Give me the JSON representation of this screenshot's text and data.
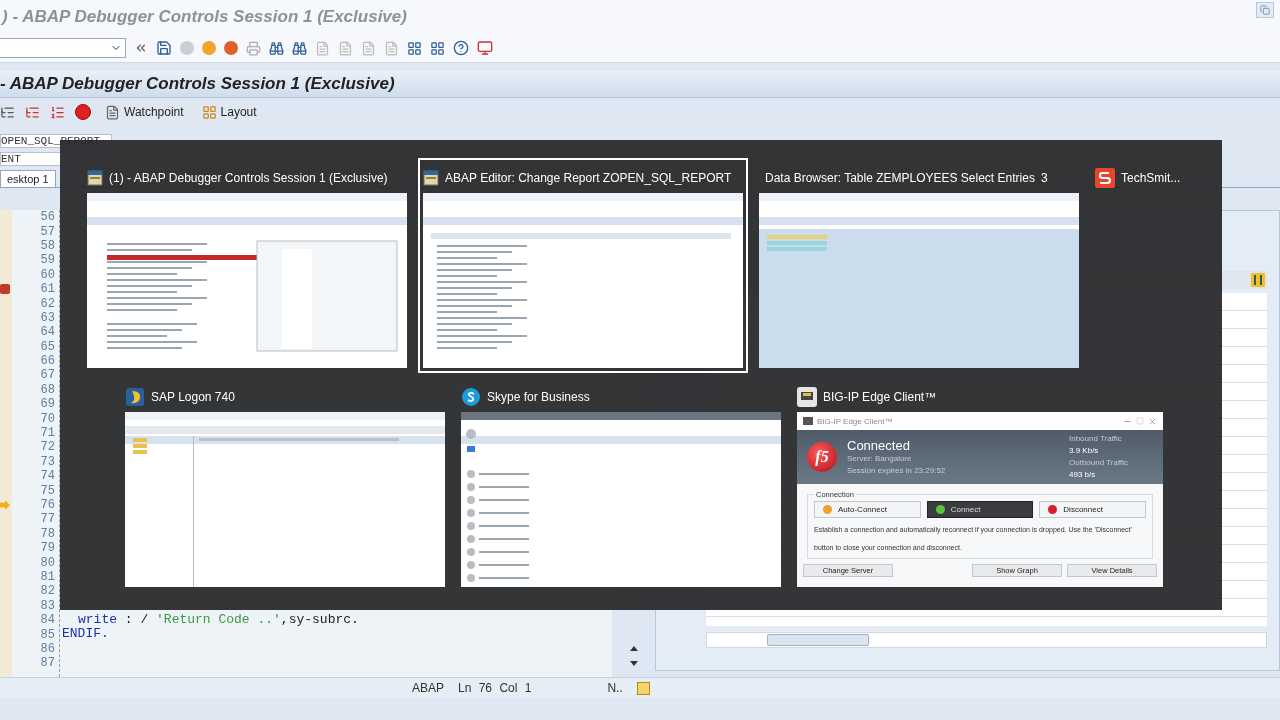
{
  "window": {
    "title": ") - ABAP Debugger Controls Session 1 (Exclusive)"
  },
  "screen_title": "- ABAP Debugger Controls Session 1 (Exclusive)",
  "app_toolbar": [
    {
      "label": "Watchpoint",
      "kind": "page"
    },
    {
      "label": "Layout",
      "kind": "layout"
    }
  ],
  "fields": [
    "OPEN_SQL_REPORT",
    "ENT"
  ],
  "tabs": [
    {
      "label": "esktop 1",
      "selected": true
    }
  ],
  "editor": {
    "lines": [
      {
        "number": "56",
        "breakpoint": false,
        "current": false
      },
      {
        "number": "57",
        "breakpoint": false,
        "current": false
      },
      {
        "number": "58",
        "breakpoint": false,
        "current": false
      },
      {
        "number": "59",
        "breakpoint": false,
        "current": false
      },
      {
        "number": "60",
        "breakpoint": false,
        "current": false
      },
      {
        "number": "61",
        "breakpoint": true,
        "current": false
      },
      {
        "number": "62",
        "breakpoint": false,
        "current": false
      },
      {
        "number": "63",
        "breakpoint": false,
        "current": false
      },
      {
        "number": "64",
        "breakpoint": false,
        "current": false
      },
      {
        "number": "65",
        "breakpoint": false,
        "current": false
      },
      {
        "number": "66",
        "breakpoint": false,
        "current": false
      },
      {
        "number": "67",
        "breakpoint": false,
        "current": false
      },
      {
        "number": "68",
        "breakpoint": false,
        "current": false
      },
      {
        "number": "69",
        "breakpoint": false,
        "current": false
      },
      {
        "number": "70",
        "breakpoint": false,
        "current": false
      },
      {
        "number": "71",
        "breakpoint": false,
        "current": false
      },
      {
        "number": "72",
        "breakpoint": false,
        "current": false
      },
      {
        "number": "73",
        "breakpoint": false,
        "current": false
      },
      {
        "number": "74",
        "breakpoint": false,
        "current": false
      },
      {
        "number": "75",
        "breakpoint": false,
        "current": false
      },
      {
        "number": "76",
        "breakpoint": false,
        "current": true
      },
      {
        "number": "77",
        "breakpoint": false,
        "current": false
      },
      {
        "number": "78",
        "breakpoint": false,
        "current": false
      },
      {
        "number": "79",
        "breakpoint": false,
        "current": false
      },
      {
        "number": "80",
        "breakpoint": false,
        "current": false
      },
      {
        "number": "81",
        "breakpoint": false,
        "current": false
      },
      {
        "number": "82",
        "breakpoint": false,
        "current": false
      },
      {
        "number": "83",
        "breakpoint": false,
        "current": false
      },
      {
        "number": "84",
        "breakpoint": false,
        "current": false,
        "tokens": [
          {
            "text": "write",
            "kind": "keyword"
          },
          {
            "text": " : / ",
            "kind": "plain"
          },
          {
            "text": "'Return Code ..'",
            "kind": "string"
          },
          {
            "text": ",sy-subrc.",
            "kind": "plain"
          }
        ]
      },
      {
        "number": "85",
        "breakpoint": false,
        "current": false,
        "tokens": [
          {
            "text": "ENDIF.",
            "kind": "keyword"
          }
        ]
      },
      {
        "number": "86",
        "breakpoint": false,
        "current": false
      },
      {
        "number": "87",
        "breakpoint": false,
        "current": false
      }
    ]
  },
  "status_bar": {
    "language": "ABAP",
    "position": "Ln 76 Col 1",
    "mode": "N.."
  },
  "switcher": {
    "rows": [
      [
        {
          "title": "(1) - ABAP Debugger Controls Session 1 (Exclusive)",
          "kind": "thumbnail",
          "selected": false
        },
        {
          "title": "ABAP Editor: Change Report ZOPEN_SQL_REPORT",
          "kind": "thumbnail",
          "selected": true
        },
        {
          "title": "Data Browser: Table ZEMPLOYEES Select Entries",
          "count": "3",
          "kind": "thumbnail",
          "selected": false
        },
        {
          "title": "TechSmit...",
          "kind": "title-only",
          "selected": false
        }
      ],
      [
        {
          "title": "SAP Logon 740",
          "kind": "thumbnail",
          "selected": false
        },
        {
          "title": "Skype for Business",
          "kind": "thumbnail",
          "selected": false
        },
        {
          "title": "BIG-IP Edge Client™",
          "kind": "app-window",
          "selected": false
        }
      ]
    ]
  },
  "vpn_window": {
    "title": "BIG-IP Edge Client™",
    "logo": "f5",
    "status": "Connected",
    "server": "Server: Bangalore",
    "session": "Session expires in 23:29:52",
    "traffic": [
      {
        "label": "Inbound Traffic",
        "value": "3.9 Kb/s"
      },
      {
        "label": "Outbound Traffic",
        "value": "493 b/s"
      }
    ],
    "group_label": "Connection",
    "modes": [
      {
        "label": "Auto-Connect",
        "color": "#f0a030",
        "selected": false
      },
      {
        "label": "Connect",
        "color": "#5cc23c",
        "selected": true
      },
      {
        "label": "Disconnect",
        "color": "#d4202a",
        "selected": false
      }
    ],
    "description": "Establish a connection and automatically reconnect if your connection is dropped. Use the 'Disconnect' button to close your connection and disconnect.",
    "buttons": [
      "Change Server",
      "Show Graph",
      "View Details"
    ]
  }
}
